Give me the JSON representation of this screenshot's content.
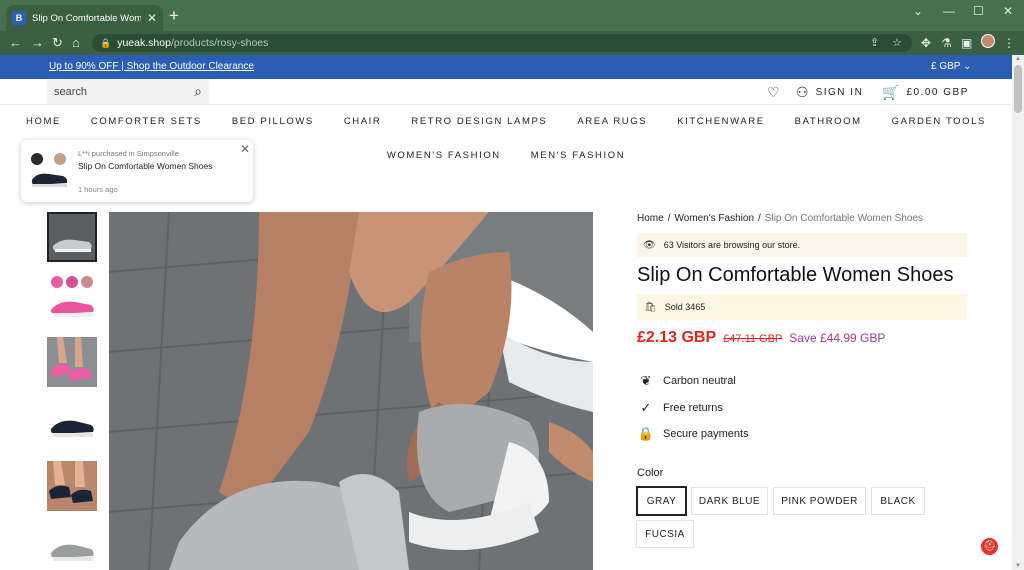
{
  "browser": {
    "tab_title": "Slip On Comfortable Women Sh",
    "favicon_letter": "B",
    "url_host": "yueak.shop",
    "url_path": "/products/rosy-shoes"
  },
  "promo": {
    "text": "Up to 90% OFF | Shop the Outdoor Clearance",
    "currency": "£ GBP"
  },
  "header": {
    "search_placeholder": "search",
    "sign_in": "SIGN IN",
    "cart": "£0.00 GBP"
  },
  "nav": {
    "row1": [
      "HOME",
      "COMFORTER SETS",
      "BED PILLOWS",
      "CHAIR",
      "RETRO DESIGN LAMPS",
      "AREA RUGS",
      "KITCHENWARE",
      "BATHROOM",
      "GARDEN TOOLS"
    ],
    "row2": [
      "WOMEN'S FASHION",
      "MEN'S FASHION"
    ]
  },
  "notification": {
    "subtitle": "L**i purchased in Simpsonville",
    "title": "Slip On Comfortable Women Shoes",
    "time": "1 hours ago"
  },
  "breadcrumb": {
    "home": "Home",
    "category": "Women's Fashion",
    "current": "Slip On Comfortable Women Shoes"
  },
  "product": {
    "visitors": "63 Visitors are browsing our store.",
    "title": "Slip On Comfortable Women Shoes",
    "sold": "Sold 3465",
    "price": "£2.13 GBP",
    "old_price": "£47.11 GBP",
    "save": "Save £44.99 GBP",
    "features": [
      "Carbon neutral",
      "Free returns",
      "Secure payments"
    ],
    "color_label": "Color",
    "colors": [
      "GRAY",
      "DARK BLUE",
      "PINK POWDER",
      "BLACK",
      "FUCSIA"
    ],
    "selected_color": "GRAY"
  },
  "colors": {
    "chrome": "#47704f",
    "promo_bar": "#2a5db4",
    "price_red": "#e0261f",
    "save_purple": "#9b3a92"
  }
}
